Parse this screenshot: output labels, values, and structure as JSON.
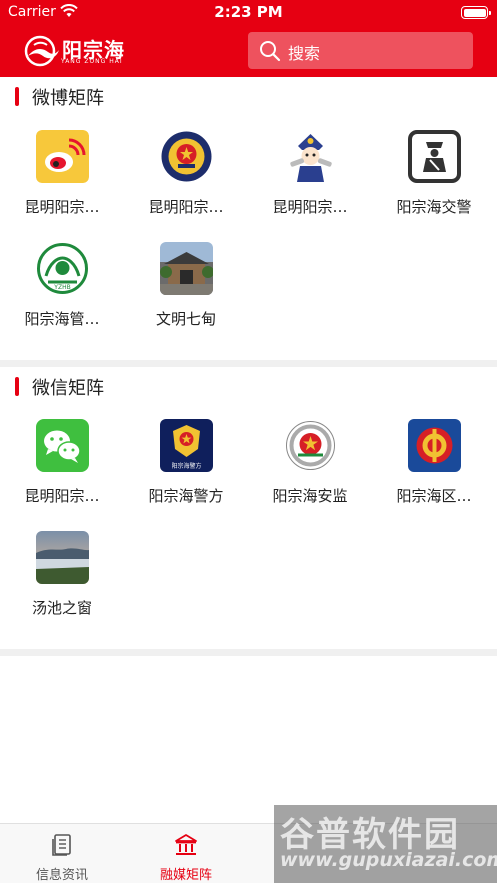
{
  "status": {
    "carrier": "Carrier",
    "time": "2:23 PM"
  },
  "header": {
    "logo_cn": "阳宗海",
    "logo_en": "YANG ZONG HAI",
    "search_placeholder": "搜索",
    "accent": "#e60012"
  },
  "weibo": {
    "title": "微博矩阵",
    "items": [
      {
        "label": "昆明阳宗…",
        "icon": "weibo-icon"
      },
      {
        "label": "昆明阳宗…",
        "icon": "police-emblem-icon"
      },
      {
        "label": "昆明阳宗…",
        "icon": "cartoon-police-icon"
      },
      {
        "label": "阳宗海交警",
        "icon": "traffic-police-icon"
      },
      {
        "label": "阳宗海管…",
        "icon": "yzhb-emblem-icon"
      },
      {
        "label": "文明七甸",
        "icon": "building-photo-icon"
      }
    ]
  },
  "wechat": {
    "title": "微信矩阵",
    "items": [
      {
        "label": "昆明阳宗…",
        "icon": "wechat-icon"
      },
      {
        "label": "阳宗海警方",
        "icon": "police-badge-icon",
        "caption": "阳宗海警方"
      },
      {
        "label": "阳宗海安监",
        "icon": "national-emblem-icon"
      },
      {
        "label": "阳宗海区…",
        "icon": "union-emblem-icon"
      },
      {
        "label": "汤池之窗",
        "icon": "lake-photo-icon"
      }
    ]
  },
  "tabbar": {
    "tabs": [
      {
        "label": "信息资讯",
        "icon": "news-icon",
        "active": false
      },
      {
        "label": "融媒矩阵",
        "icon": "institution-icon",
        "active": true
      }
    ],
    "active_color": "#e60012",
    "inactive_color": "#555555"
  },
  "watermark": {
    "brand": "谷普软件园",
    "url": "www.gupuxiazai.com"
  }
}
